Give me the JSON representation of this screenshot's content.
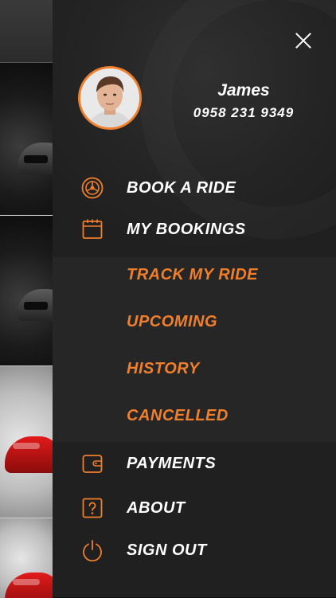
{
  "colors": {
    "accent": "#f07f2c",
    "drawer_bg": "#202020",
    "text": "#ffffff"
  },
  "user": {
    "name": "James",
    "phone": "0958 231 9349"
  },
  "menu": {
    "close_icon": "close-icon",
    "items": [
      {
        "label": "BOOK A RIDE",
        "icon": "steering-wheel-icon"
      },
      {
        "label": "MY BOOKINGS",
        "icon": "calendar-icon"
      },
      {
        "label": "PAYMENTS",
        "icon": "wallet-icon"
      },
      {
        "label": "ABOUT",
        "icon": "question-icon"
      },
      {
        "label": "SIGN OUT",
        "icon": "power-icon"
      }
    ],
    "bookings_sub": [
      {
        "label": "TRACK MY RIDE"
      },
      {
        "label": "UPCOMING"
      },
      {
        "label": "HISTORY"
      },
      {
        "label": "CANCELLED"
      }
    ]
  }
}
